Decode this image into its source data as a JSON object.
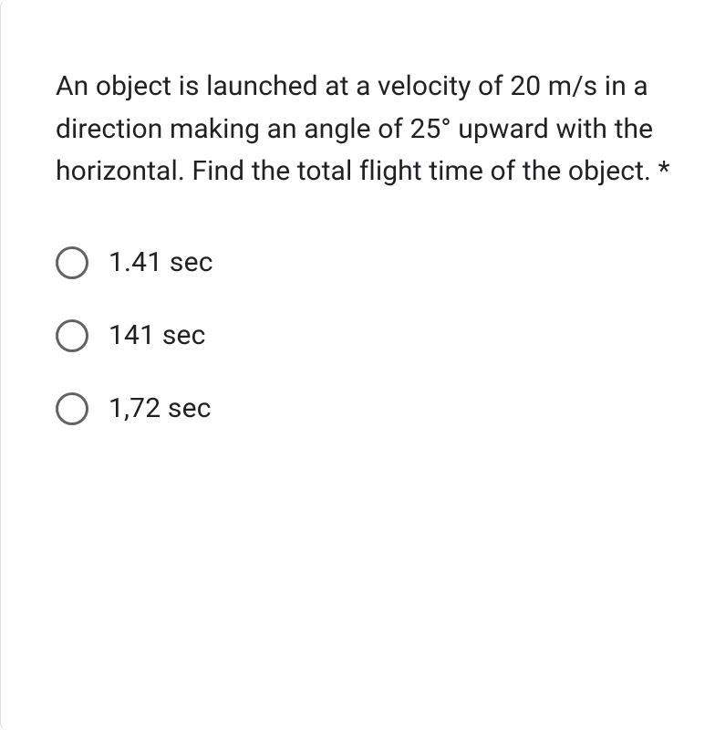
{
  "question": {
    "text": "An object is launched at a velocity of 20 m/s in a direction making an angle of 25° upward with the horizontal. Find the total flight time of the object.",
    "required_marker": " *"
  },
  "options": [
    {
      "label": "1.41 sec"
    },
    {
      "label": "141 sec"
    },
    {
      "label": "1,72 sec"
    }
  ]
}
